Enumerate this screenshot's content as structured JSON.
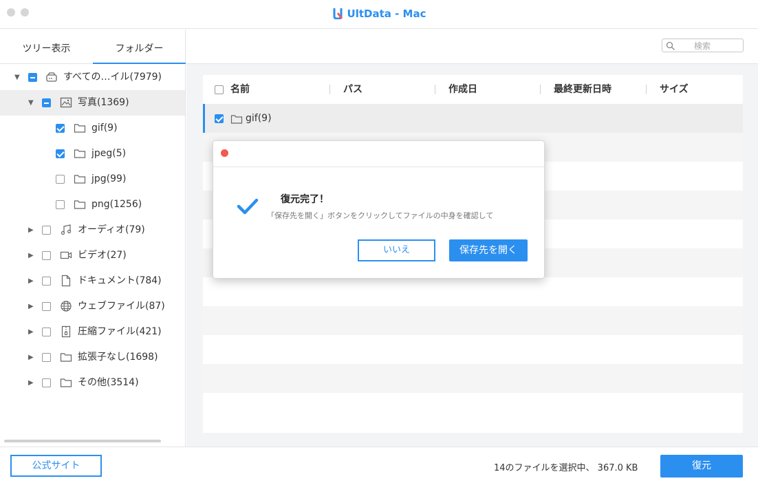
{
  "window": {
    "title": "UltData - Mac",
    "accent_color": "#2b8ff0"
  },
  "sidebar": {
    "tabs": [
      {
        "label": "ツリー表示",
        "active": false
      },
      {
        "label": "フォルダー",
        "active": true
      }
    ],
    "tree": [
      {
        "label": "すべての…イル(7979)",
        "icon": "drive-icon",
        "state": "partial",
        "expanded": true
      },
      {
        "label": "写真(1369)",
        "icon": "image-icon",
        "state": "partial",
        "expanded": true
      },
      {
        "label": "gif(9)",
        "icon": "folder-icon",
        "state": "checked"
      },
      {
        "label": "jpeg(5)",
        "icon": "folder-icon",
        "state": "checked"
      },
      {
        "label": "jpg(99)",
        "icon": "folder-icon",
        "state": "unchecked"
      },
      {
        "label": "png(1256)",
        "icon": "folder-icon",
        "state": "unchecked"
      },
      {
        "label": "オーディオ(79)",
        "icon": "music-icon",
        "state": "unchecked"
      },
      {
        "label": "ビデオ(27)",
        "icon": "video-icon",
        "state": "unchecked"
      },
      {
        "label": "ドキュメント(784)",
        "icon": "document-icon",
        "state": "unchecked"
      },
      {
        "label": "ウェブファイル(87)",
        "icon": "globe-icon",
        "state": "unchecked"
      },
      {
        "label": "圧縮ファイル(421)",
        "icon": "archive-icon",
        "state": "unchecked"
      },
      {
        "label": "拡張子なし(1698)",
        "icon": "folder-icon",
        "state": "unchecked"
      },
      {
        "label": "その他(3514)",
        "icon": "folder-icon",
        "state": "unchecked"
      }
    ]
  },
  "search": {
    "placeholder": "検索"
  },
  "table": {
    "columns": [
      "名前",
      "パス",
      "作成日",
      "最終更新日時",
      "サイズ"
    ],
    "rows": [
      {
        "name": "gif(9)",
        "checked": true,
        "icon": "folder-icon"
      }
    ]
  },
  "dialog": {
    "title": "復元完了！",
    "message": "「保存先を開く」ボタンをクリックしてファイルの中身を確認して",
    "no_label": "いいえ",
    "open_label": "保存先を開く",
    "close_color": "#f15a4f"
  },
  "footer": {
    "site_label": "公式サイト",
    "status": "14のファイルを選択中、 367.0 KB",
    "restore_label": "復元"
  }
}
